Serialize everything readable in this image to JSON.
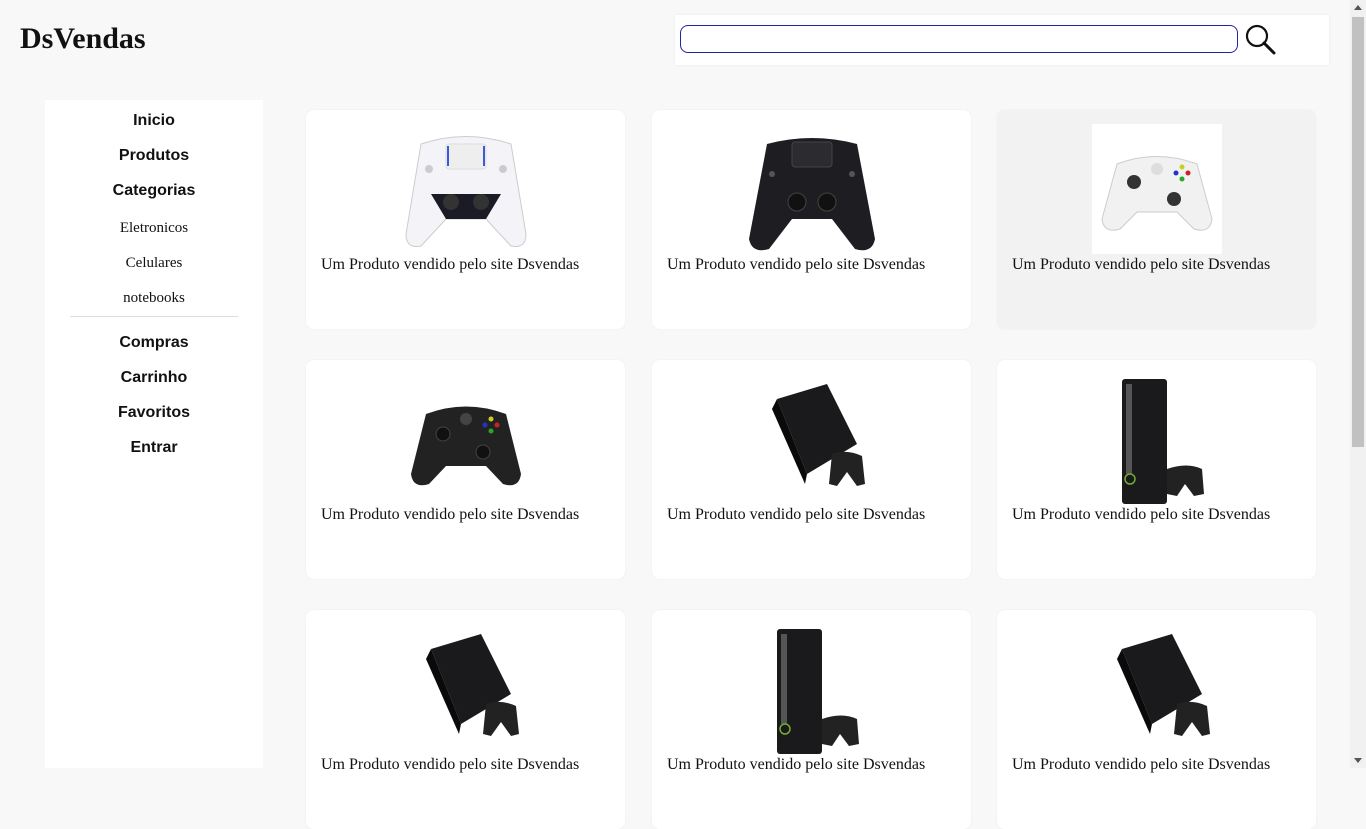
{
  "header": {
    "logo": "DsVendas",
    "search": {
      "value": "",
      "placeholder": ""
    }
  },
  "sidebar": {
    "top_items": [
      "Inicio",
      "Produtos",
      "Categorias"
    ],
    "categories": [
      "Eletronicos",
      "Celulares",
      "notebooks"
    ],
    "bottom_items": [
      "Compras",
      "Carrinho",
      "Favoritos",
      "Entrar"
    ]
  },
  "products": [
    {
      "caption": "Um Produto vendido pelo site Dsvendas",
      "image": "ps5-controller"
    },
    {
      "caption": "Um Produto vendido pelo site Dsvendas",
      "image": "ps4-controller"
    },
    {
      "caption": "Um Produto vendido pelo site Dsvendas",
      "image": "xbox-white-controller"
    },
    {
      "caption": "Um Produto vendido pelo site Dsvendas",
      "image": "xbox-black-controller"
    },
    {
      "caption": "Um Produto vendido pelo site Dsvendas",
      "image": "ps3-slim-console"
    },
    {
      "caption": "Um Produto vendido pelo site Dsvendas",
      "image": "xbox360-elite-console"
    },
    {
      "caption": "Um Produto vendido pelo site Dsvendas",
      "image": "ps3-slim-console"
    },
    {
      "caption": "Um Produto vendido pelo site Dsvendas",
      "image": "xbox360-elite-console"
    },
    {
      "caption": "Um Produto vendido pelo site Dsvendas",
      "image": "ps3-slim-console"
    }
  ],
  "colors": {
    "background": "#f8f8f8",
    "search_border": "#2222aa",
    "hover_card": "#f2f2f2"
  }
}
